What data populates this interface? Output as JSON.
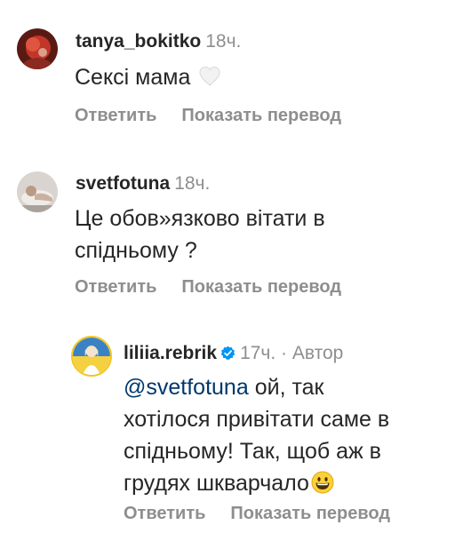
{
  "comments": [
    {
      "username": "tanya_bokitko",
      "time": "18ч.",
      "text": "Сексі мама",
      "emoji": "white-heart-icon",
      "reply_label": "Ответить",
      "translate_label": "Показать перевод"
    },
    {
      "username": "svetfotuna",
      "time": "18ч.",
      "text_line1": "Це обов»язково вітати в",
      "text_line2": "спідньому ?",
      "reply_label": "Ответить",
      "translate_label": "Показать перевод"
    }
  ],
  "reply": {
    "username": "liliia.rebrik",
    "verified_icon": "verified-badge-icon",
    "time": "17ч.",
    "separator": " · ",
    "author_label": "Автор",
    "mention": "@svetfotuna",
    "text_line1_rest": " ой, так",
    "text_line2": "хотілося привітати саме в",
    "text_line3": "спідньому! Так, щоб аж в",
    "text_line4": "грудях шкварчало",
    "emoji": "grinning-face-icon",
    "reply_label": "Ответить",
    "translate_label": "Показать перевод"
  },
  "colors": {
    "text": "#262626",
    "secondary": "#8e8e8e",
    "mention": "#00376b",
    "verified": "#0095f6"
  }
}
